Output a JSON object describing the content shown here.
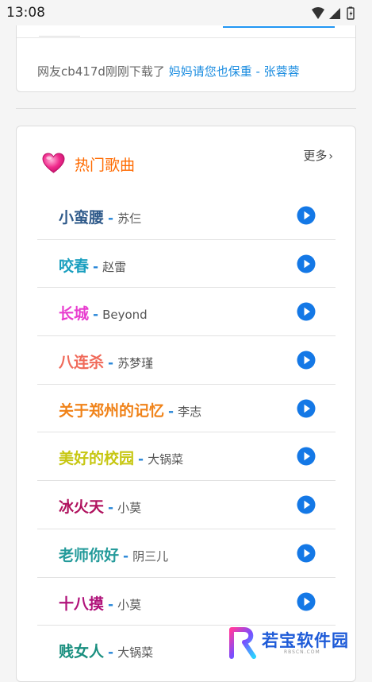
{
  "status_bar": {
    "time": "13:08",
    "icons": [
      "wifi-icon",
      "signal-icon",
      "battery-icon"
    ]
  },
  "top_card": {
    "download_notice_prefix": "网友cb417d刚刚下载了",
    "download_notice_song": "妈妈请您也保重 - 张蓉蓉",
    "link_color": "#1a8ce0"
  },
  "hot_songs": {
    "title": "热门歌曲",
    "title_color": "#ff6a00",
    "more_label": "更多",
    "icon": "heart-icon",
    "play_icon": "play-circle-icon",
    "play_color": "#1478e6",
    "items": [
      {
        "title": "小蛮腰",
        "artist": "苏仨",
        "color": "#2f5a8a"
      },
      {
        "title": "咬春",
        "artist": "赵雷",
        "color": "#1a9fbf"
      },
      {
        "title": "长城",
        "artist": "Beyond",
        "color": "#e83ccf"
      },
      {
        "title": "八连杀",
        "artist": "苏梦瑾",
        "color": "#f06a5a"
      },
      {
        "title": "关于郑州的记忆",
        "artist": "李志",
        "color": "#f08218"
      },
      {
        "title": "美好的校园",
        "artist": "大锅菜",
        "color": "#c7c712"
      },
      {
        "title": "冰火天",
        "artist": "小莫",
        "color": "#b0125e"
      },
      {
        "title": "老师你好",
        "artist": "阴三儿",
        "color": "#239a9a"
      },
      {
        "title": "十八摸",
        "artist": "小莫",
        "color": "#b0127a"
      },
      {
        "title": "贱女人",
        "artist": "大锅菜",
        "color": "#1a8f7f"
      }
    ]
  },
  "watermark": {
    "text": "若宝软件园",
    "sub": "RBSCN.COM"
  }
}
